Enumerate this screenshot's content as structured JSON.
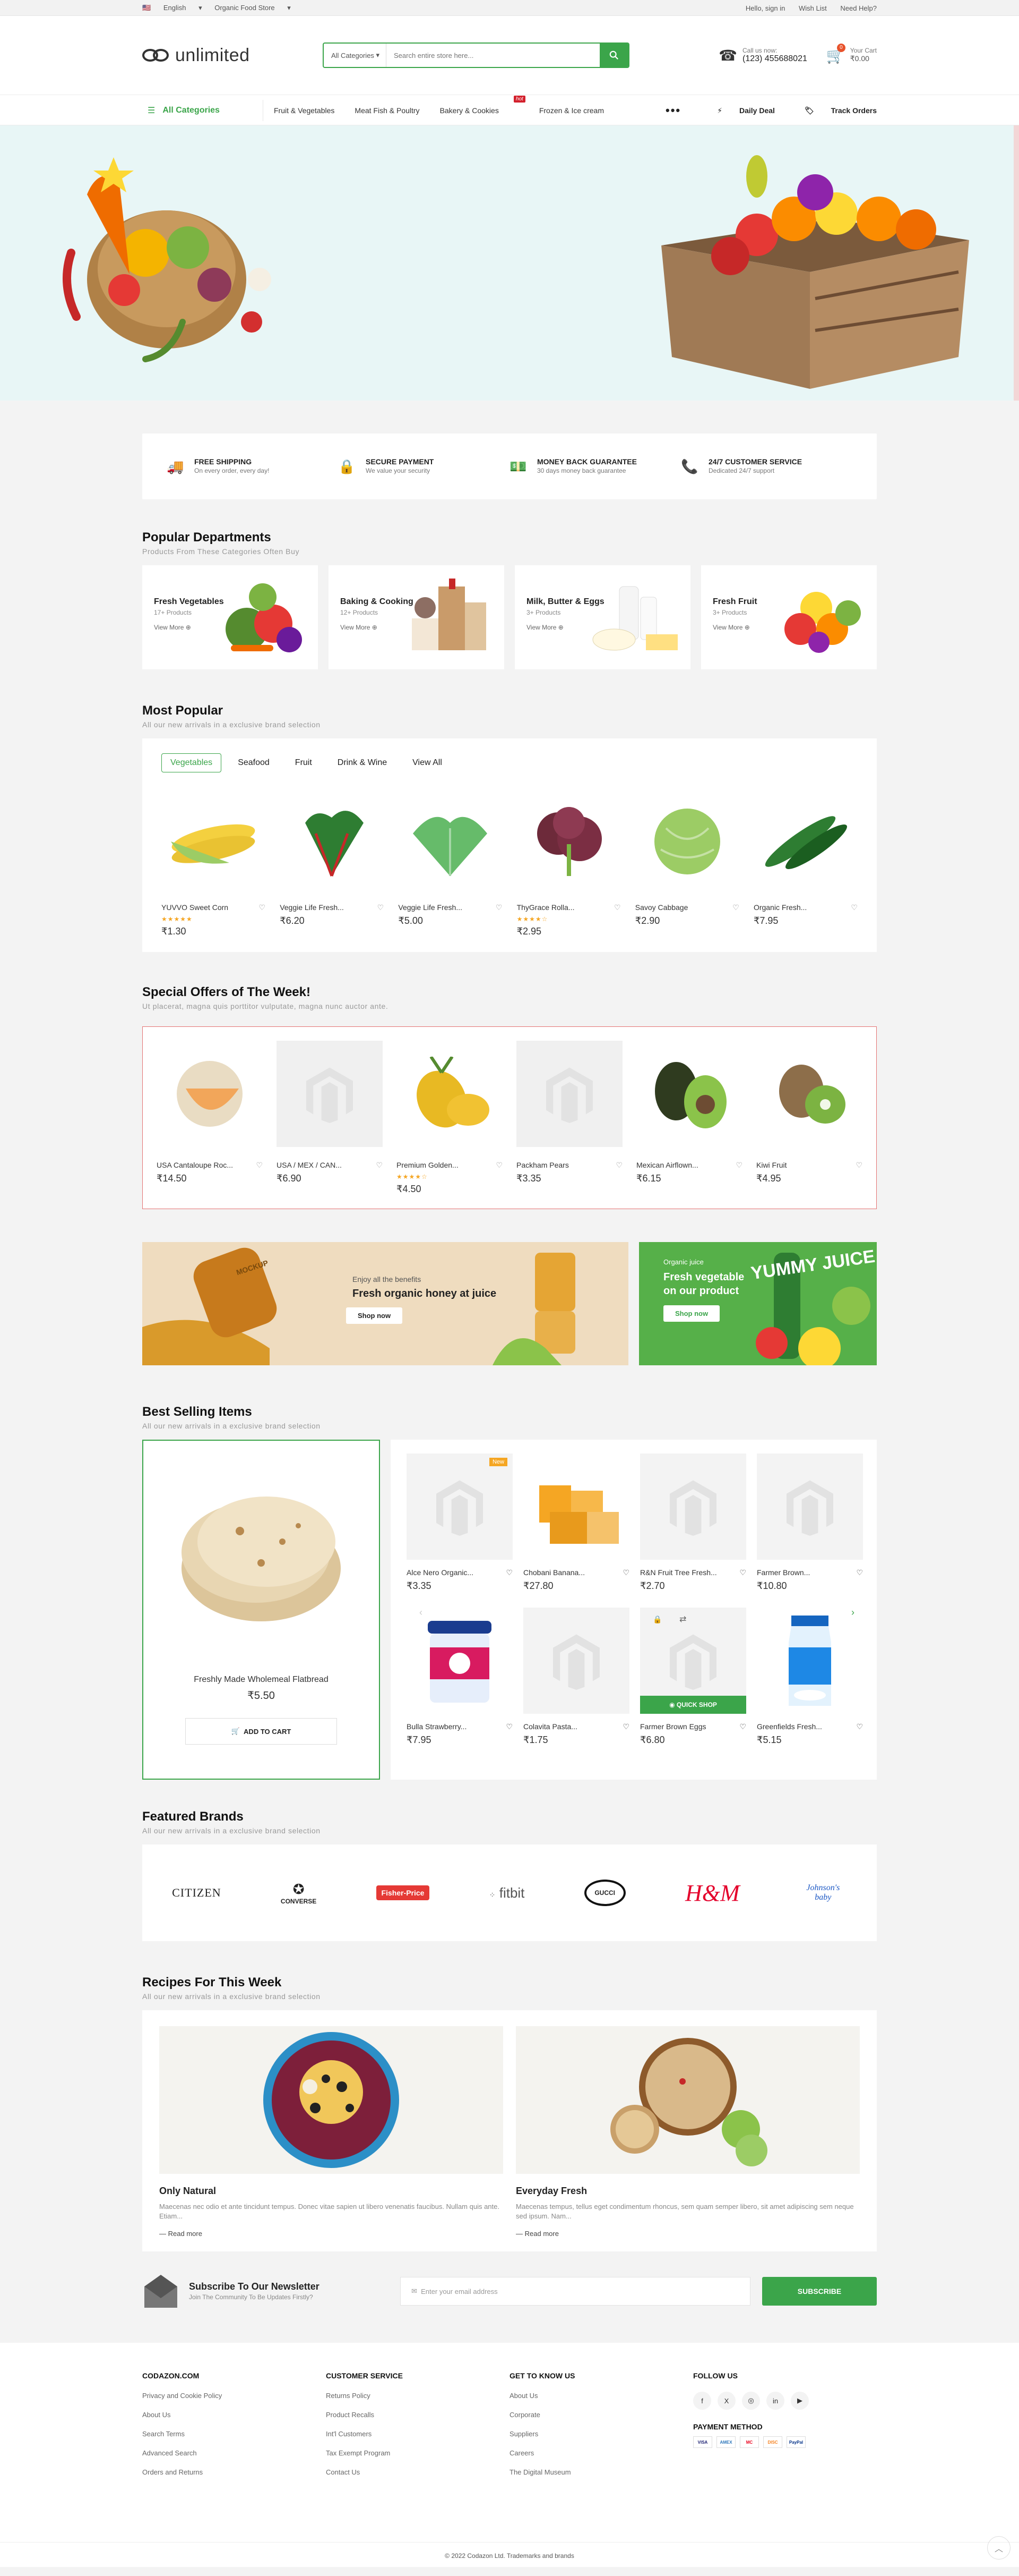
{
  "topbar": {
    "language": "English",
    "store": "Organic Food Store",
    "hello": "Hello, sign in",
    "wishlist": "Wish List",
    "help": "Need Help?"
  },
  "header": {
    "logo": "unlimited",
    "search_category": "All Categories",
    "search_placeholder": "Search entire store here...",
    "call_label": "Call us now:",
    "call_number": "(123) 455688021",
    "cart_label": "Your Cart",
    "cart_total": "₹0.00",
    "cart_count": "0"
  },
  "nav": {
    "all_categories": "All Categories",
    "items": [
      "Fruit & Vegetables",
      "Meat Fish & Poultry",
      "Bakery & Cookies",
      "Frozen & Ice cream"
    ],
    "hot_tag": "hot",
    "daily_deal": "Daily Deal",
    "track_orders": "Track Orders"
  },
  "features": [
    {
      "title": "FREE SHIPPING",
      "sub": "On every order, every day!"
    },
    {
      "title": "SECURE PAYMENT",
      "sub": "We value your security"
    },
    {
      "title": "MONEY BACK GUARANTEE",
      "sub": "30 days money back guarantee"
    },
    {
      "title": "24/7 CUSTOMER SERVICE",
      "sub": "Dedicated 24/7 support"
    }
  ],
  "departments": {
    "title": "Popular Departments",
    "sub": "Products From These Categories Often Buy",
    "view_more": "View More",
    "items": [
      {
        "name": "Fresh Vegetables",
        "count": "17+ Products"
      },
      {
        "name": "Baking & Cooking",
        "count": "12+ Products"
      },
      {
        "name": "Milk, Butter & Eggs",
        "count": "3+ Products"
      },
      {
        "name": "Fresh Fruit",
        "count": "3+ Products"
      }
    ]
  },
  "popular": {
    "title": "Most Popular",
    "sub": "All our new arrivals in a exclusive brand selection",
    "tabs": [
      "Vegetables",
      "Seafood",
      "Fruit",
      "Drink & Wine",
      "View All"
    ],
    "products": [
      {
        "name": "YUVVO Sweet Corn",
        "price": "₹1.30",
        "stars": "★★★★★"
      },
      {
        "name": "Veggie Life Fresh...",
        "price": "₹6.20",
        "stars": ""
      },
      {
        "name": "Veggie Life Fresh...",
        "price": "₹5.00",
        "stars": ""
      },
      {
        "name": "ThyGrace Rolla...",
        "price": "₹2.95",
        "stars": "★★★★☆"
      },
      {
        "name": "Savoy Cabbage",
        "price": "₹2.90",
        "stars": ""
      },
      {
        "name": "Organic Fresh...",
        "price": "₹7.95",
        "stars": ""
      }
    ]
  },
  "special": {
    "title": "Special Offers of The Week!",
    "sub": "Ut placerat, magna quis porttitor vulputate, magna nunc auctor ante.",
    "products": [
      {
        "name": "USA Cantaloupe Roc...",
        "price": "₹14.50",
        "stars": ""
      },
      {
        "name": "USA / MEX / CAN...",
        "price": "₹6.90",
        "stars": ""
      },
      {
        "name": "Premium Golden...",
        "price": "₹4.50",
        "stars": "★★★★☆"
      },
      {
        "name": "Packham Pears",
        "price": "₹3.35",
        "stars": ""
      },
      {
        "name": "Mexican Airflown...",
        "price": "₹6.15",
        "stars": ""
      },
      {
        "name": "Kiwi Fruit",
        "price": "₹4.95",
        "stars": ""
      }
    ]
  },
  "banners": {
    "b1_small": "Enjoy all the benefits",
    "b1_title": "Fresh organic honey at juice",
    "b1_btn": "Shop now",
    "b1_jar": "MOCKUP",
    "b2_small": "Organic juice",
    "b2_title": "Fresh vegetable on our product",
    "b2_btn": "Shop now",
    "b2_art": "YUMMY JUICE"
  },
  "best": {
    "title": "Best Selling Items",
    "sub": "All our new arrivals in a exclusive brand selection",
    "featured_name": "Freshly Made Wholemeal Flatbread",
    "featured_price": "₹5.50",
    "add_to_cart": "ADD TO CART",
    "new_tag": "New",
    "quick_shop": "QUICK SHOP",
    "items": [
      {
        "name": "Alce Nero Organic...",
        "price": "₹3.35"
      },
      {
        "name": "Chobani Banana...",
        "price": "₹27.80"
      },
      {
        "name": "R&N Fruit Tree Fresh...",
        "price": "₹2.70"
      },
      {
        "name": "Farmer Brown...",
        "price": "₹10.80"
      },
      {
        "name": "Bulla Strawberry...",
        "price": "₹7.95"
      },
      {
        "name": "Colavita Pasta...",
        "price": "₹1.75"
      },
      {
        "name": "Farmer Brown Eggs",
        "price": "₹6.80"
      },
      {
        "name": "Greenfields Fresh...",
        "price": "₹5.15"
      }
    ]
  },
  "brands": {
    "title": "Featured Brands",
    "sub": "All our new arrivals in a exclusive brand selection",
    "items": [
      "CITIZEN",
      "CONVERSE",
      "Fisher-Price",
      "fitbit",
      "GUCCI",
      "H&M",
      "Johnson's baby"
    ]
  },
  "recipes": {
    "title": "Recipes For This Week",
    "sub": "All our new arrivals in a exclusive brand selection",
    "items": [
      {
        "title": "Only Natural",
        "text": "Maecenas nec odio et ante tincidunt tempus. Donec vitae sapien ut libero venenatis faucibus. Nullam quis ante. Etiam...",
        "more": "Read more"
      },
      {
        "title": "Everyday Fresh",
        "text": "Maecenas tempus, tellus eget condimentum rhoncus, sem quam semper libero, sit amet adipiscing sem neque sed ipsum. Nam...",
        "more": "Read more"
      }
    ]
  },
  "newsletter": {
    "title": "Subscribe To Our Newsletter",
    "sub": "Join The Community To Be Updates Firstly?",
    "placeholder": "Enter your email address",
    "btn": "SUBSCRIBE"
  },
  "footer": {
    "cols": [
      {
        "title": "CODAZON.COM",
        "links": [
          "Privacy and Cookie Policy",
          "About Us",
          "Search Terms",
          "Advanced Search",
          "Orders and Returns"
        ]
      },
      {
        "title": "CUSTOMER SERVICE",
        "links": [
          "Returns Policy",
          "Product Recalls",
          "Int'l Customers",
          "Tax Exempt Program",
          "Contact Us"
        ]
      },
      {
        "title": "GET TO KNOW US",
        "links": [
          "About Us",
          "Corporate",
          "Suppliers",
          "Careers",
          "The Digital Museum"
        ]
      }
    ],
    "follow_title": "FOLLOW US",
    "socials": [
      "f",
      "X",
      "◎",
      "in",
      "▶"
    ],
    "payment_title": "PAYMENT METHOD",
    "payments": [
      "VISA",
      "AMEX",
      "MC",
      "DISC",
      "PayPal"
    ],
    "copyright": "© 2022 Codazon Ltd. Trademarks and brands"
  },
  "colors": {
    "brand": "#3ba54a",
    "accent": "#e8522b",
    "offer_border": "#e57373"
  }
}
